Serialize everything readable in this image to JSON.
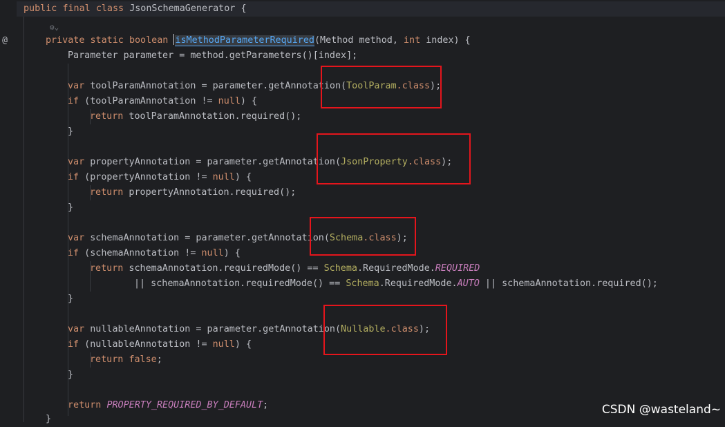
{
  "gutter": {
    "override_icon": "@"
  },
  "fold_hint": "⚙⌄",
  "code": {
    "l1_public": "public",
    "l1_final": "final",
    "l1_class": "class",
    "l1_name": "JsonSchemaGenerator",
    "l1_brace": "{",
    "m_private": "private",
    "m_static": "static",
    "m_boolean": "boolean",
    "m_name": "isMethodParameterRequired",
    "m_params_a": "(Method method, ",
    "m_int": "int",
    "m_params_b": " index) {",
    "l3": "Parameter parameter = method.getParameters()[index];",
    "var": "var",
    "if": "if",
    "null": "null",
    "return": "return",
    "close": "}",
    "tp_decl": " toolParamAnnotation = parameter.getAnnotation(",
    "tp_cls": "ToolParam",
    "dot_class": ".class",
    "end_paren": ");",
    "tp_if_a": " (toolParamAnnotation != ",
    "if_end": ") {",
    "tp_ret": " toolParamAnnotation.required();",
    "jp_decl": " propertyAnnotation = parameter.getAnnotation(",
    "jp_cls": "JsonProperty",
    "jp_if_a": " (propertyAnnotation != ",
    "jp_ret": " propertyAnnotation.required();",
    "sc_decl": " schemaAnnotation = parameter.getAnnotation(",
    "sc_cls": "Schema",
    "sc_if_a": " (schemaAnnotation != ",
    "sc_ret_a": " schemaAnnotation.requiredMode() == ",
    "sc_rm": ".RequiredMode.",
    "sc_required": "REQUIRED",
    "sc_or_a": "|| schemaAnnotation.requiredMode() == ",
    "sc_auto": "AUTO",
    "sc_or_b": " || schemaAnnotation.required();",
    "nl_decl": " nullableAnnotation = parameter.getAnnotation(",
    "nl_cls": "Nullable",
    "nl_if_a": " (nullableAnnotation != ",
    "false": "false",
    "semi": ";",
    "default_const": "PROPERTY_REQUIRED_BY_DEFAULT",
    "final_close": "}"
  },
  "watermark": "CSDN @wasteland~",
  "colors": {
    "keyword": "#cf8e6d",
    "method": "#56a8f5",
    "annotation": "#b3ae60",
    "constant": "#c77dbb",
    "highlight_box": "#e5151c"
  }
}
